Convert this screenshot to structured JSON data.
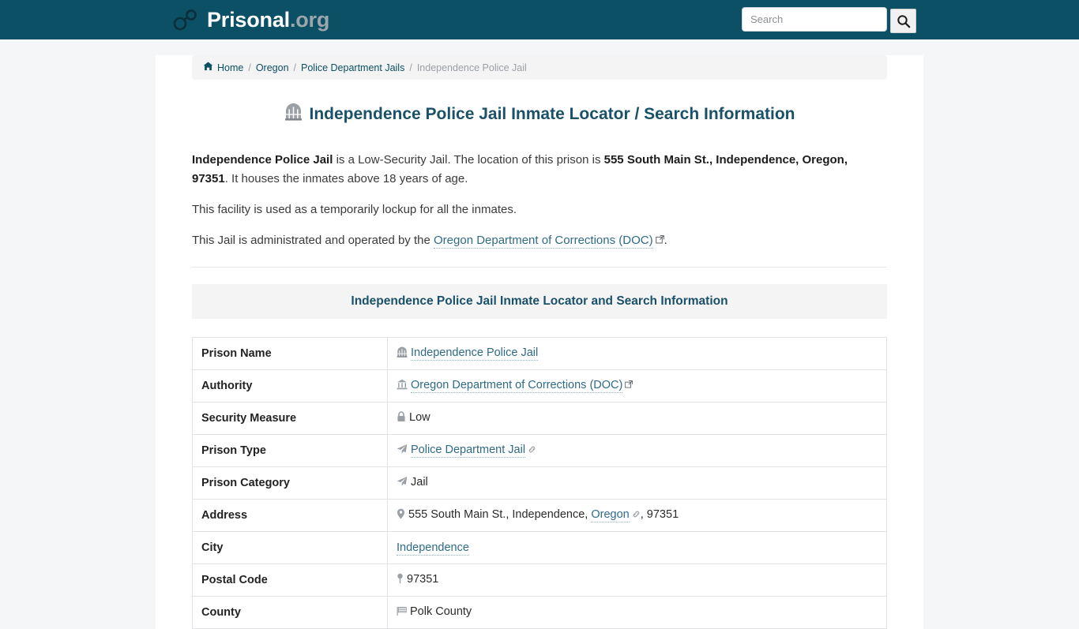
{
  "header": {
    "brand_name": "Prisonal",
    "brand_tld": ".org",
    "brand_icon": "handcuffs-icon",
    "search_placeholder": "Search",
    "search_value": "",
    "search_button_icon": "search-icon"
  },
  "breadcrumb": {
    "home_icon": "home-icon",
    "items": [
      {
        "label": "Home",
        "current": false
      },
      {
        "label": "Oregon",
        "current": false
      },
      {
        "label": "Police Department Jails",
        "current": false
      },
      {
        "label": "Independence Police Jail",
        "current": true
      }
    ],
    "separator": "/"
  },
  "title": {
    "icon": "prison-gate-icon",
    "text": "Independence Police Jail Inmate Locator / Search Information"
  },
  "intro": {
    "p1_a": "Independence Police Jail",
    "p1_b": " is a Low-Security Jail. The location of this prison is ",
    "p1_c": "555 South Main St., Independence, Oregon, 97351",
    "p1_d": ". It houses the inmates above 18 years of age.",
    "p2": "This facility is used as a temporarily lockup for all the inmates.",
    "p3_a": "This Jail is administrated and operated by the ",
    "p3_link": "Oregon Department of Corrections (DOC)",
    "p3_b": "."
  },
  "section": {
    "heading": "Independence Police Jail Inmate Locator and Search Information"
  },
  "table": {
    "rows": [
      {
        "key": "Prison Name",
        "value": "Independence Police Jail",
        "icon": "prison-gate-icon",
        "link": true,
        "trailing_icon": ""
      },
      {
        "key": "Authority",
        "value": "Oregon Department of Corrections (DOC)",
        "icon": "bank-icon",
        "link": true,
        "trailing_icon": "external-link-icon"
      },
      {
        "key": "Security Measure",
        "value": "Low",
        "icon": "lock-icon",
        "link": false,
        "trailing_icon": ""
      },
      {
        "key": "Prison Type",
        "value": "Police Department Jail",
        "icon": "paper-plane-icon",
        "link": true,
        "trailing_icon": "chain-link-icon"
      },
      {
        "key": "Prison Category",
        "value": "Jail",
        "icon": "paper-plane-icon",
        "link": false,
        "trailing_icon": ""
      },
      {
        "key": "Address",
        "value": "555 South Main St., Independence, Oregon, 97351",
        "icon": "map-pin-icon",
        "link": false,
        "trailing_icon": ""
      },
      {
        "key": "City",
        "value": "Independence",
        "icon": "",
        "link": true,
        "trailing_icon": ""
      },
      {
        "key": "Postal Code",
        "value": "97351",
        "icon": "map-marker-icon",
        "link": false,
        "trailing_icon": ""
      },
      {
        "key": "County",
        "value": "Polk County",
        "icon": "flag-icon",
        "link": false,
        "trailing_icon": ""
      }
    ],
    "address_parts": {
      "before": "555 South Main St., Independence, ",
      "link": "Oregon",
      "after": ", 97351"
    }
  },
  "colors": {
    "header_bg": "#0b5064",
    "brand_name": "#ffffff",
    "brand_tld": "#9aa6ab",
    "title": "#1b5168",
    "link": "#2f6b86",
    "band_bg": "#f4f4f5",
    "page_bg": "#f5f6f8"
  }
}
